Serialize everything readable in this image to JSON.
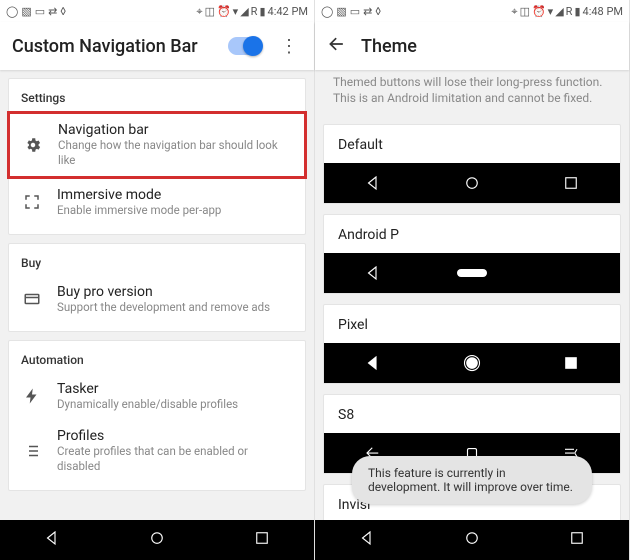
{
  "left": {
    "status": {
      "time": "4:42 PM",
      "net": "R"
    },
    "appbar": {
      "title": "Custom Navigation Bar"
    },
    "sections": {
      "settings": {
        "label": "Settings",
        "items": [
          {
            "title": "Navigation bar",
            "sub": "Change how the navigation bar should look like"
          },
          {
            "title": "Immersive mode",
            "sub": "Enable immersive mode per-app"
          }
        ]
      },
      "buy": {
        "label": "Buy",
        "items": [
          {
            "title": "Buy pro version",
            "sub": "Support the development and remove ads"
          }
        ]
      },
      "automation": {
        "label": "Automation",
        "items": [
          {
            "title": "Tasker",
            "sub": "Dynamically enable/disable profiles"
          },
          {
            "title": "Profiles",
            "sub": "Create profiles that can be enabled or disabled"
          }
        ]
      }
    }
  },
  "right": {
    "status": {
      "time": "4:48 PM",
      "net": "R"
    },
    "appbar": {
      "title": "Theme"
    },
    "hint": "Themed buttons will lose their long-press function. This is an Android limitation and cannot be fixed.",
    "themes": [
      {
        "name": "Default"
      },
      {
        "name": "Android P"
      },
      {
        "name": "Pixel"
      },
      {
        "name": "S8"
      },
      {
        "name": "Invisi"
      }
    ],
    "toast": "This feature is currently in development. It will improve over time."
  }
}
